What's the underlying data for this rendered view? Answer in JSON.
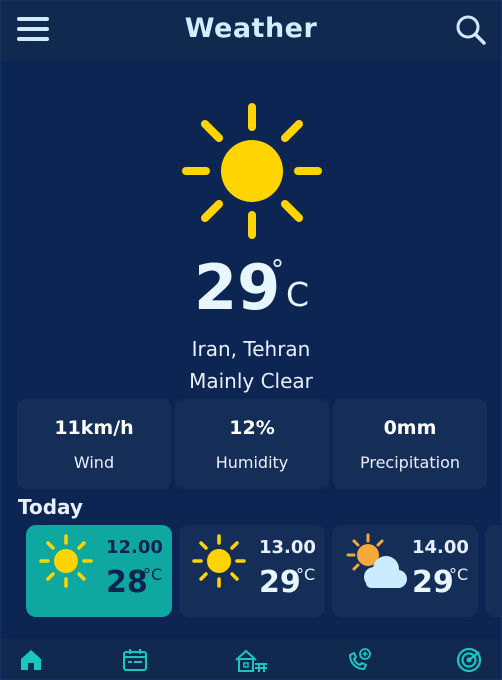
{
  "header": {
    "title": "Weather",
    "menu_icon": "menu-icon",
    "search_icon": "search-icon"
  },
  "current": {
    "icon": "sun-icon",
    "temperature": "29",
    "degree_symbol": "°",
    "unit": "C",
    "location": "Iran, Tehran",
    "condition": "Mainly Clear"
  },
  "stats": [
    {
      "value": "11km/h",
      "label": "Wind"
    },
    {
      "value": "12%",
      "label": "Humidity"
    },
    {
      "value": "0mm",
      "label": "Precipitation"
    }
  ],
  "today": {
    "label": "Today",
    "hours": [
      {
        "time": "12.00",
        "temp": "28",
        "unit": "°C",
        "icon": "sun-icon",
        "active": true
      },
      {
        "time": "13.00",
        "temp": "29",
        "unit": "°C",
        "icon": "sun-icon",
        "active": false
      },
      {
        "time": "14.00",
        "temp": "29",
        "unit": "°C",
        "icon": "partly-cloudy-icon",
        "active": false
      }
    ]
  },
  "nav": [
    {
      "icon": "home-icon",
      "active": true
    },
    {
      "icon": "calendar-icon",
      "active": false
    },
    {
      "icon": "house-icon",
      "active": false
    },
    {
      "icon": "phone-plus-icon",
      "active": false
    },
    {
      "icon": "radar-icon",
      "active": false
    }
  ],
  "colors": {
    "background": "#0d2552",
    "accent": "#0fa8a0",
    "sun": "#ffd400",
    "icon_accent": "#19c7c0"
  }
}
